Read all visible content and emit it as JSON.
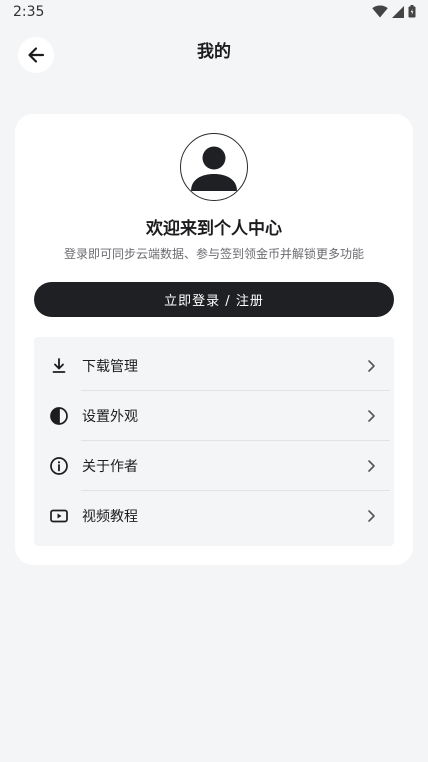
{
  "status_bar": {
    "time": "2:35"
  },
  "header": {
    "title": "我的",
    "back_icon": "arrow-left-icon"
  },
  "profile": {
    "avatar_icon": "user-avatar-icon",
    "welcome": "欢迎来到个人中心",
    "subtitle": "登录即可同步云端数据、参与签到领金币并解锁更多功能",
    "login_label": "立即登录 / 注册"
  },
  "menu": {
    "items": [
      {
        "label": "下载管理",
        "icon": "download-icon"
      },
      {
        "label": "设置外观",
        "icon": "appearance-icon"
      },
      {
        "label": "关于作者",
        "icon": "info-icon"
      },
      {
        "label": "视频教程",
        "icon": "video-icon"
      }
    ]
  },
  "colors": {
    "background": "#f4f5f7",
    "card": "#ffffff",
    "primary_button": "#1f2023",
    "text": "#1d1d1f",
    "muted_text": "#6b6b70"
  }
}
